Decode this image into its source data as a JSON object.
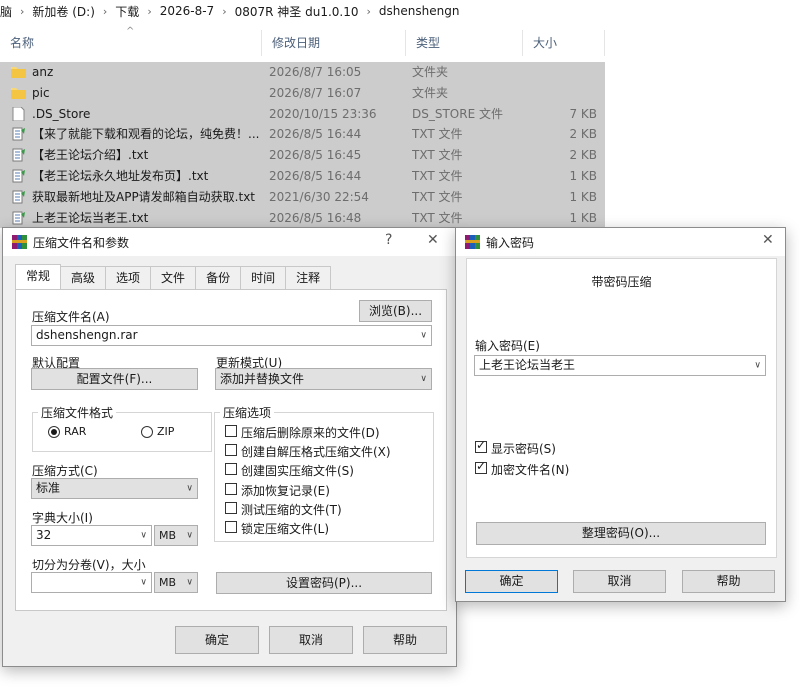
{
  "breadcrumb": [
    "电脑",
    "新加卷 (D:)",
    "下载",
    "2026-8-7",
    "0807R 神圣 du1.0.10",
    "dshenshengn"
  ],
  "explorer": {
    "columns": {
      "name": "名称",
      "date": "修改日期",
      "type": "类型",
      "size": "大小"
    },
    "files": [
      {
        "name": "anz",
        "date": "2026/8/7 16:05",
        "type": "文件夹",
        "size": "",
        "icon": "folder-icon"
      },
      {
        "name": "pic",
        "date": "2026/8/7 16:07",
        "type": "文件夹",
        "size": "",
        "icon": "folder-icon"
      },
      {
        "name": ".DS_Store",
        "date": "2020/10/15 23:36",
        "type": "DS_STORE 文件",
        "size": "7 KB",
        "icon": "file-icon"
      },
      {
        "name": "【来了就能下载和观看的论坛，纯免费！...",
        "date": "2026/8/5 16:44",
        "type": "TXT 文件",
        "size": "2 KB",
        "icon": "text-file-icon"
      },
      {
        "name": "【老王论坛介绍】.txt",
        "date": "2026/8/5 16:45",
        "type": "TXT 文件",
        "size": "2 KB",
        "icon": "text-file-icon"
      },
      {
        "name": "【老王论坛永久地址发布页】.txt",
        "date": "2026/8/5 16:44",
        "type": "TXT 文件",
        "size": "1 KB",
        "icon": "text-file-icon"
      },
      {
        "name": "获取最新地址及APP请发邮箱自动获取.txt",
        "date": "2021/6/30 22:54",
        "type": "TXT 文件",
        "size": "1 KB",
        "icon": "text-file-icon"
      },
      {
        "name": "上老王论坛当老王.txt",
        "date": "2026/8/5 16:48",
        "type": "TXT 文件",
        "size": "1 KB",
        "icon": "text-file-icon"
      }
    ]
  },
  "archive_dialog": {
    "title": "压缩文件名和参数",
    "help_glyph": "?",
    "close_glyph": "✕",
    "tabs": [
      "常规",
      "高级",
      "选项",
      "文件",
      "备份",
      "时间",
      "注释"
    ],
    "archive_name_label": "压缩文件名(A)",
    "browse_button": "浏览(B)...",
    "archive_name_value": "dshenshengn.rar",
    "default_profile_label": "默认配置",
    "profiles_button": "配置文件(F)...",
    "update_mode_label": "更新模式(U)",
    "update_mode_value": "添加并替换文件",
    "format_group": "压缩文件格式",
    "format_rar": "RAR",
    "format_zip": "ZIP",
    "method_label": "压缩方式(C)",
    "method_value": "标准",
    "dict_label": "字典大小(I)",
    "dict_value": "32",
    "dict_unit": "MB",
    "split_label": "切分为分卷(V)，大小",
    "split_value": "",
    "split_unit": "MB",
    "options_group": "压缩选项",
    "options": [
      {
        "label": "压缩后删除原来的文件(D)",
        "checked": false
      },
      {
        "label": "创建自解压格式压缩文件(X)",
        "checked": false
      },
      {
        "label": "创建固实压缩文件(S)",
        "checked": false
      },
      {
        "label": "添加恢复记录(E)",
        "checked": false
      },
      {
        "label": "测试压缩的文件(T)",
        "checked": false
      },
      {
        "label": "锁定压缩文件(L)",
        "checked": false
      }
    ],
    "set_password_button": "设置密码(P)...",
    "ok_button": "确定",
    "cancel_button": "取消",
    "help_button": "帮助"
  },
  "password_dialog": {
    "title": "输入密码",
    "close_glyph": "✕",
    "heading": "带密码压缩",
    "password_label": "输入密码(E)",
    "password_value": "上老王论坛当老王",
    "show_password_label": "显示密码(S)",
    "show_password_checked": true,
    "encrypt_names_label": "加密文件名(N)",
    "encrypt_names_checked": true,
    "organize_button": "整理密码(O)...",
    "ok_button": "确定",
    "cancel_button": "取消",
    "help_button": "帮助"
  },
  "colors": {
    "selection": "#cccccc",
    "accent": "#0078d7",
    "folder": "#f8d775"
  }
}
